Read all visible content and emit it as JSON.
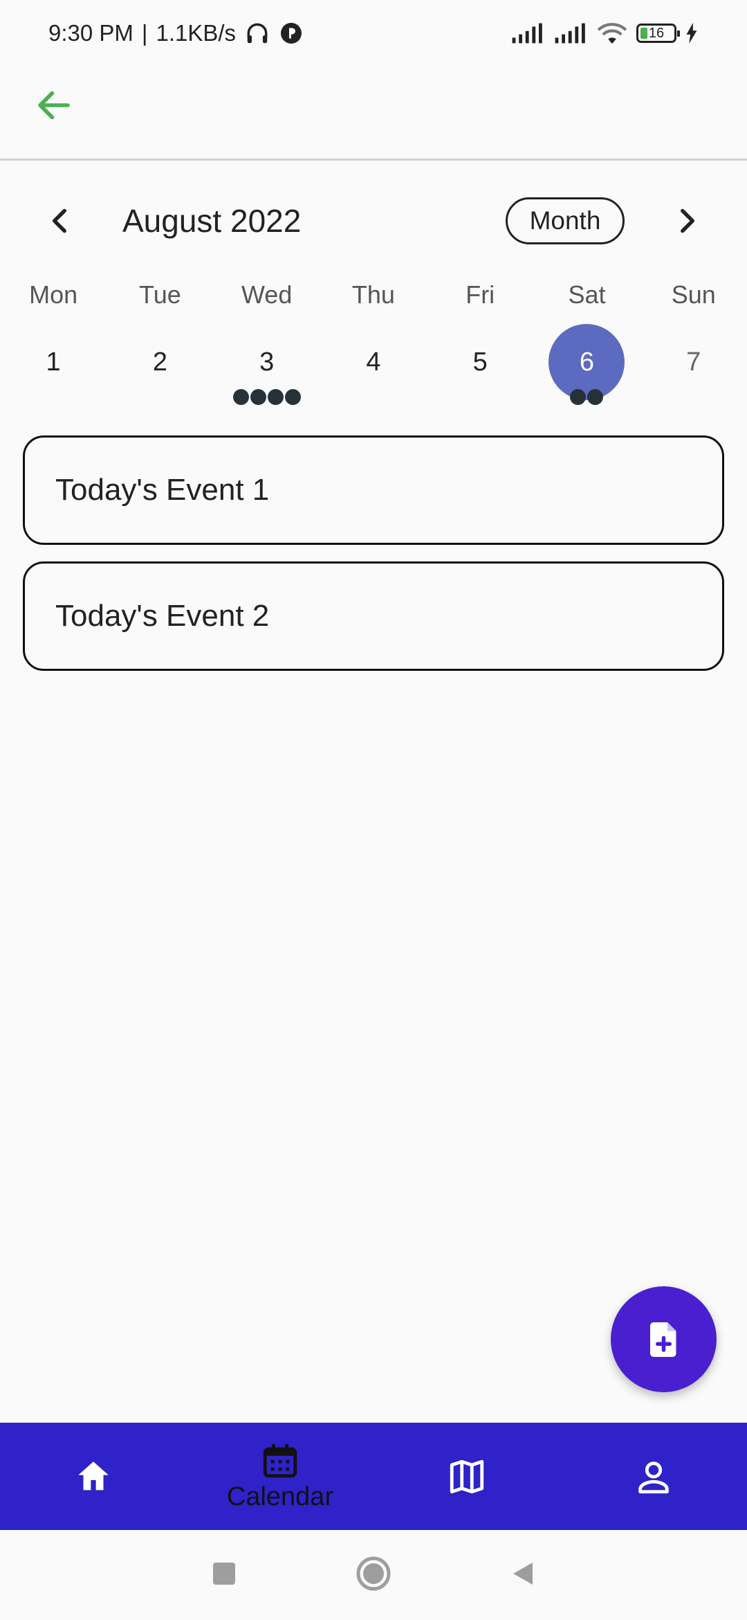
{
  "status_bar": {
    "time": "9:30 PM",
    "separator": "|",
    "net_speed": "1.1KB/s",
    "battery_level": "16"
  },
  "calendar": {
    "month_title": "August 2022",
    "format_button": "Month",
    "weekdays": [
      "Mon",
      "Tue",
      "Wed",
      "Thu",
      "Fri",
      "Sat",
      "Sun"
    ],
    "days": [
      {
        "label": "1",
        "markers": 0
      },
      {
        "label": "2",
        "markers": 0
      },
      {
        "label": "3",
        "markers": 4
      },
      {
        "label": "4",
        "markers": 0
      },
      {
        "label": "5",
        "markers": 0
      },
      {
        "label": "6",
        "markers": 2,
        "selected": true
      },
      {
        "label": "7",
        "markers": 0
      }
    ],
    "selected_color": "#5c6bc0"
  },
  "events": [
    {
      "title": "Today's Event 1"
    },
    {
      "title": "Today's Event 2"
    }
  ],
  "fab": {
    "icon": "add-document-icon",
    "color": "#4a1fd0"
  },
  "bottom_nav": {
    "background": "#2e22c8",
    "items": [
      {
        "icon": "home-icon",
        "label": ""
      },
      {
        "icon": "calendar-icon",
        "label": "Calendar",
        "active": true
      },
      {
        "icon": "map-icon",
        "label": ""
      },
      {
        "icon": "person-icon",
        "label": ""
      }
    ]
  },
  "accent": {
    "back_arrow": "#4caf50"
  }
}
